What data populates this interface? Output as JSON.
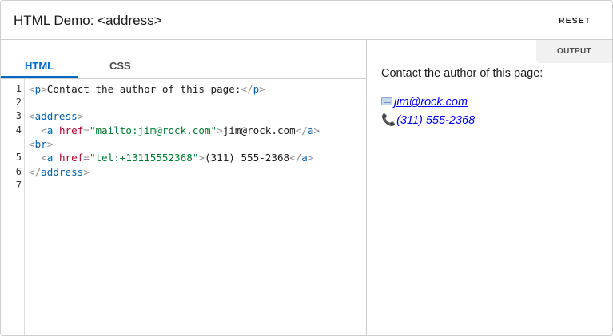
{
  "header": {
    "title": "HTML Demo: <address>",
    "reset_label": "RESET"
  },
  "editor": {
    "tabs": [
      {
        "label": "HTML",
        "active": true
      },
      {
        "label": "CSS",
        "active": false
      }
    ],
    "line_numbers": [
      "1",
      "2",
      "3",
      "4",
      "5",
      "6",
      "7"
    ],
    "code": {
      "line1": {
        "open_tag": "p",
        "text": "Contact the author of this page:",
        "close_tag": "p"
      },
      "line3": {
        "tag": "address"
      },
      "line4": {
        "tag": "a",
        "attr": "href",
        "value": "\"mailto:jim@rock.com\"",
        "text": "jim@rock.com",
        "close_tag": "a"
      },
      "line4b": {
        "tag": "br"
      },
      "line5": {
        "tag": "a",
        "attr": "href",
        "value": "\"tel:+13115552368\"",
        "text": "(311) 555-2368",
        "close_tag": "a"
      },
      "line6": {
        "close_tag": "address"
      }
    },
    "colors": {
      "tag": "#0062b0",
      "attr": "#b2002d",
      "string": "#007a30",
      "punct": "#8a8a8a",
      "active_tab": "#0069c2"
    }
  },
  "output": {
    "label": "OUTPUT",
    "paragraph": "Contact the author of this page:",
    "email_link": "jim@rock.com",
    "phone_link": "(311) 555-2368",
    "email_icon": "envelope-icon",
    "phone_icon": "telephone-icon",
    "phone_glyph": "📞"
  }
}
